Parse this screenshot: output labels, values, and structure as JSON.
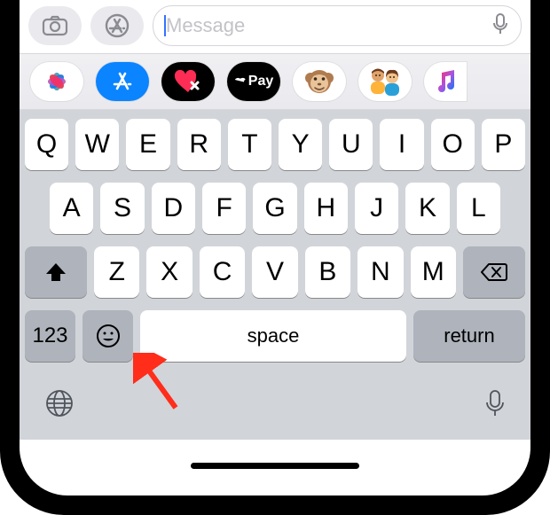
{
  "input_bar": {
    "placeholder": "Message"
  },
  "app_strip": {
    "apps": [
      {
        "name": "photos"
      },
      {
        "name": "app-store"
      },
      {
        "name": "digital-touch"
      },
      {
        "name": "apple-pay",
        "label": "Pay"
      },
      {
        "name": "memoji"
      },
      {
        "name": "people"
      },
      {
        "name": "music"
      }
    ]
  },
  "keyboard": {
    "row1": [
      "Q",
      "W",
      "E",
      "R",
      "T",
      "Y",
      "U",
      "I",
      "O",
      "P"
    ],
    "row2": [
      "A",
      "S",
      "D",
      "F",
      "G",
      "H",
      "J",
      "K",
      "L"
    ],
    "row3": [
      "Z",
      "X",
      "C",
      "V",
      "B",
      "N",
      "M"
    ],
    "numbers_label": "123",
    "space_label": "space",
    "return_label": "return"
  }
}
